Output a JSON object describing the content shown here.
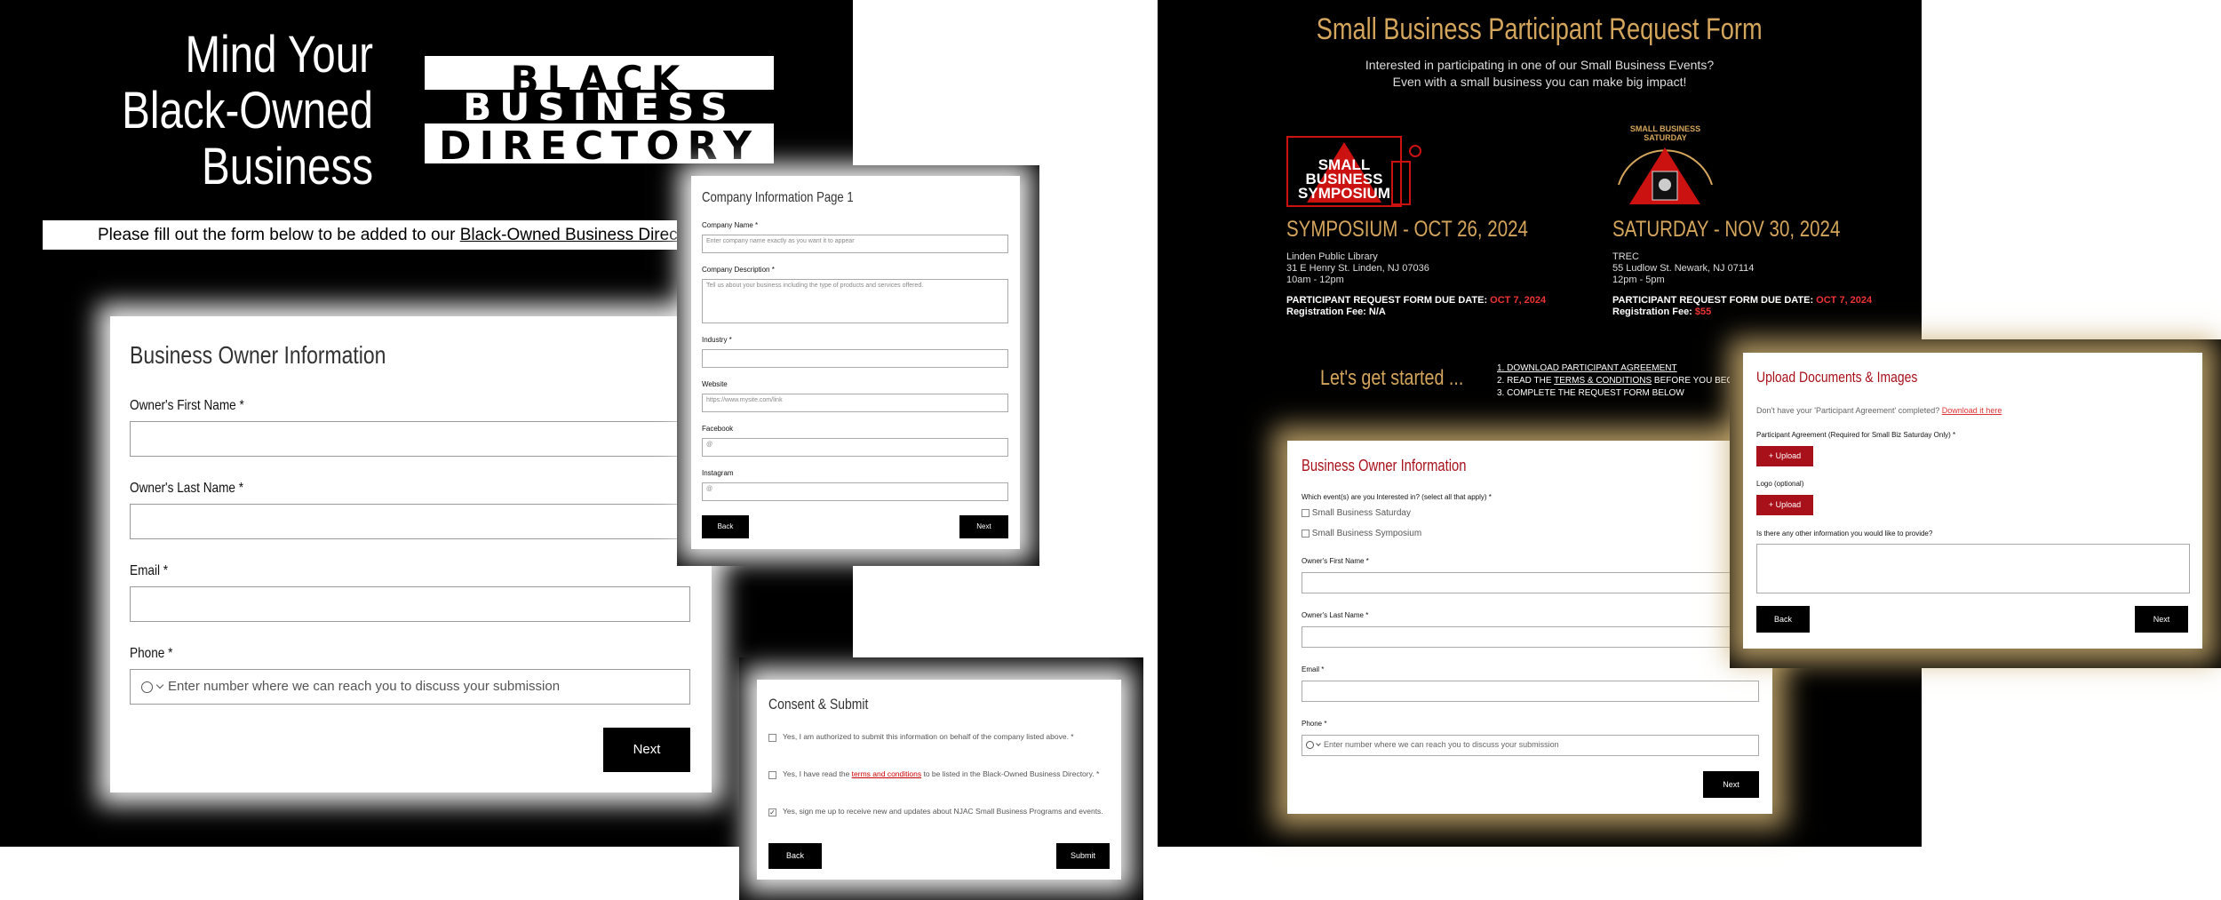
{
  "left": {
    "title_lines": [
      "Mind Your",
      "Black-Owned",
      "Business"
    ],
    "logo_lines": [
      "BLACK",
      "BUSINESS",
      "DIRECTORY"
    ],
    "instruction_prefix": "Please fill out the form below to be added to our ",
    "instruction_link": "Black-Owned Business Directory"
  },
  "owner_form": {
    "title": "Business Owner Information",
    "first_name_label": "Owner's First Name *",
    "last_name_label": "Owner's Last Name *",
    "email_label": "Email *",
    "phone_label": "Phone *",
    "phone_placeholder": "Enter number where we can reach you to discuss your submission",
    "next": "Next"
  },
  "company_form": {
    "title": "Company Information Page 1",
    "name_label": "Company Name *",
    "name_placeholder": "Enter company name exactly as you want it to appear",
    "desc_label": "Company Description *",
    "desc_placeholder": "Tell us about your business including the type of products and services offered.",
    "industry_label": "Industry *",
    "website_label": "Website",
    "website_placeholder": "https://www.mysite.com/link",
    "facebook_label": "Facebook",
    "facebook_placeholder": "@",
    "instagram_label": "Instagram",
    "instagram_placeholder": "@",
    "back": "Back",
    "next": "Next"
  },
  "consent_form": {
    "title": "Consent & Submit",
    "item1": "Yes, I am authorized to submit this information on behalf of the company listed above. *",
    "item2_prefix": "Yes, I have read the ",
    "item2_link": "terms and conditions",
    "item2_suffix": " to be listed in the Black-Owned Business Directory. *",
    "item3": "Yes, sign me up to receive new and updates about NJAC Small Business Programs and events.",
    "item3_checked": true,
    "back": "Back",
    "submit": "Submit"
  },
  "right": {
    "title": "Small Business Participant Request Form",
    "subtitle1": "Interested in participating in one of our Small Business Events?",
    "subtitle2": "Even with a small business you can make big impact!",
    "symposium_logo": [
      "SMALL",
      "BUSINESS",
      "SYMPOSIUM"
    ],
    "saturday_logo": "SMALL BUSINESS SATURDAY",
    "event1": {
      "heading": "SYMPOSIUM - OCT 26, 2024",
      "venue": "Linden Public Library",
      "address": "31 E Henry St. Linden, NJ 07036",
      "time": "10am - 12pm",
      "due_prefix": "PARTICIPANT REQUEST FORM DUE DATE: ",
      "due_date": "OCT 7, 2024",
      "fee_prefix": "Registration Fee: ",
      "fee": "N/A"
    },
    "event2": {
      "heading": "SATURDAY - NOV 30, 2024",
      "venue": "TREC",
      "address": "55 Ludlow St. Newark, NJ 07114",
      "time": "12pm - 5pm",
      "due_prefix": "PARTICIPANT REQUEST FORM DUE DATE: ",
      "due_date": "OCT 7, 2024",
      "fee_prefix": "Registration Fee: ",
      "fee": "$55"
    },
    "get_started": "Let's get started ...",
    "step1": "1. DOWNLOAD PARTICIPANT AGREEMENT",
    "step2_prefix": "2. READ THE ",
    "step2_link": "TERMS & CONDITIONS",
    "step2_suffix": " BEFORE YOU BEGIN",
    "step3": "3. COMPLETE THE REQUEST FORM BELOW"
  },
  "participant_form": {
    "title": "Business Owner Information",
    "events_label": "Which event(s) are you Interested in? (select all that apply) *",
    "option1": "Small Business Saturday",
    "option2": "Small Business Symposium",
    "first_name_label": "Owner's First Name *",
    "last_name_label": "Owner's Last Name *",
    "email_label": "Email *",
    "phone_label": "Phone *",
    "phone_placeholder": "Enter number where we can reach you to discuss your submission",
    "next": "Next"
  },
  "upload_form": {
    "title": "Upload Documents & Images",
    "note_prefix": "Don't have your 'Participant Agreement' completed? ",
    "note_link": "Download it here",
    "agreement_label": "Participant Agreement (Required for Small Biz Saturday Only) *",
    "upload": "+ Upload",
    "logo_label": "Logo (optional)",
    "other_label": "Is there any other information you would like to provide?",
    "back": "Back",
    "next": "Next"
  },
  "colors": {
    "gold": "#d4a55c",
    "red": "#a8101a",
    "due_red": "#e33"
  }
}
